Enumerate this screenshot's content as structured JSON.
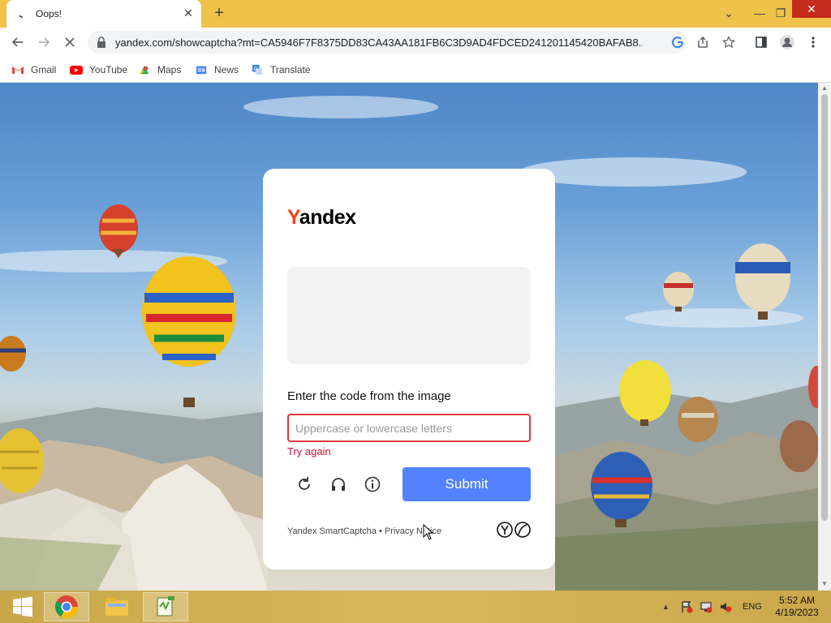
{
  "browser": {
    "tab_title": "Oops!",
    "url": "yandex.com/showcaptcha?mt=CA5946F7F8375DD83CA43AA181FB6C3D9AD4FDCED241201145420BAFAB8...",
    "bookmarks": [
      {
        "label": "Gmail",
        "icon": "gmail-icon"
      },
      {
        "label": "YouTube",
        "icon": "youtube-icon"
      },
      {
        "label": "Maps",
        "icon": "maps-icon"
      },
      {
        "label": "News",
        "icon": "news-icon"
      },
      {
        "label": "Translate",
        "icon": "translate-icon"
      }
    ]
  },
  "captcha": {
    "logo_text_first": "Y",
    "logo_text_rest": "andex",
    "prompt": "Enter the code from the image",
    "input_placeholder": "Uppercase or lowercase letters",
    "input_value": "",
    "error": "Try again",
    "submit_label": "Submit",
    "footer": "Yandex SmartCaptcha • Privacy Notice"
  },
  "taskbar": {
    "language": "ENG",
    "time": "5:52 AM",
    "date": "4/19/2023"
  },
  "colors": {
    "accent": "#5282ff",
    "error": "#c8102e",
    "brand": "#fc3f1d",
    "titlebar": "#efc24a"
  }
}
